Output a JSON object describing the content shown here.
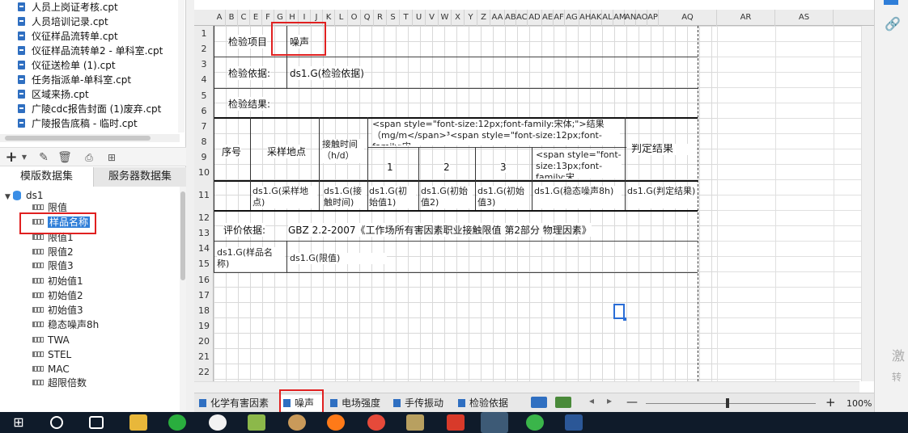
{
  "file_list": [
    "人员上岗证考核.cpt",
    "人员培训记录.cpt",
    "仪征样品流转单.cpt",
    "仪征样品流转单2 - 单科室.cpt",
    "仪征送检单  (1).cpt",
    "任务指派单-单科室.cpt",
    "区域来扬.cpt",
    "广陵cdc报告封面 (1)废弃.cpt",
    "广陵报告底稿 - 临时.cpt"
  ],
  "dataset_tabs": [
    "模版数据集",
    "服务器数据集"
  ],
  "tree": {
    "root": "ds1",
    "fields": [
      "限值",
      "样品名称",
      "限值1",
      "限值2",
      "限值3",
      "初始值1",
      "初始值2",
      "初始值3",
      "稳态噪声8h",
      "TWA",
      "STEL",
      "MAC",
      "超限倍数"
    ],
    "selected": "样品名称"
  },
  "columns": [
    "A",
    "B",
    "C",
    "E",
    "F",
    "G",
    "H",
    "I",
    "J",
    "K",
    "L",
    "O",
    "Q",
    "R",
    "S",
    "T",
    "U",
    "V",
    "W",
    "X",
    "Y",
    "Z",
    "AA",
    "AB",
    "AC",
    "AD",
    "AE",
    "AF",
    "AG",
    "AH",
    "AK",
    "AL",
    "AM",
    "AN",
    "AO",
    "AP",
    "AQ",
    "AR",
    "AS"
  ],
  "rows": [
    "1",
    "2",
    "3",
    "4",
    "5",
    "6",
    "7",
    "8",
    "9",
    "10",
    "11",
    "12",
    "13",
    "14",
    "15",
    "16",
    "17",
    "18",
    "19",
    "20",
    "21",
    "22"
  ],
  "report": {
    "item_label": "检验项目",
    "item_value": "噪声",
    "basis_label": "检验依据:",
    "basis_value": "ds1.G(检验依据)",
    "result_label": "检验结果:",
    "col_seq": "序号",
    "col_location": "采样地点",
    "col_time": "接触时间（h/d）",
    "col_result_html": "<span style=\"font-size:12px;font-family:宋体;\">结果（mg/m</span>³<span style=\"font-size:12px;font-family:宋",
    "col_result_html2": "font-family:宋体;\">(mg/m...",
    "col_judge": "判定结果",
    "sub1": "1",
    "sub2": "2",
    "sub3": "3",
    "sub4_html": "<span style=\"font-size:13px;font-family:宋",
    "d_location": "ds1.G(采样地点)",
    "d_time": "ds1.G(接触时间)",
    "d_init1": "ds1.G(初始值1)",
    "d_init2": "ds1.G(初始值2)",
    "d_init3": "ds1.G(初始值3)",
    "d_noise": "ds1.G(稳态噪声8h)",
    "d_judge": "ds1.G(判定结果)",
    "eval_label": "评价依据:",
    "eval_value": "GBZ 2.2-2007《工作场所有害因素职业接触限值 第2部分 物理因素》",
    "d_sample": "ds1.G(样品名称)",
    "d_limit": "ds1.G(限值)"
  },
  "sheet_tabs": [
    "化学有害因素",
    "噪声",
    "电场强度",
    "手传振动",
    "检验依据"
  ],
  "active_sheet": "噪声",
  "zoom": "100%",
  "watermark": [
    "激",
    "转"
  ]
}
